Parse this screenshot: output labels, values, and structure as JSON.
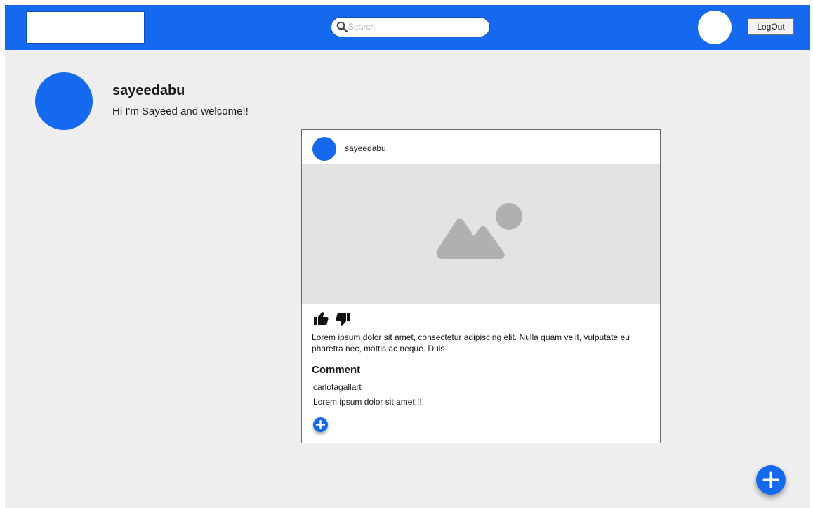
{
  "navbar": {
    "search": {
      "placeholder": "Search",
      "icon": "search-icon"
    },
    "logout_label": "LogOut",
    "accent_color": "#1569ef"
  },
  "profile": {
    "username": "sayeedabu",
    "bio": "Hi I'm Sayeed and welcome!!"
  },
  "post": {
    "author": "sayeedabu",
    "image_icon": "image-placeholder-icon",
    "reactions": [
      "thumbs-up-icon",
      "thumbs-down-icon"
    ],
    "text": "Lorem ipsum dolor sit amet, consectetur adipiscing elit. Nulla quam velit, vulputate eu pharetra nec, mattis ac neque. Duis",
    "comments_heading": "Comment",
    "comments": [
      {
        "user": "carlotagallart",
        "text": "Lorem ipsum dolor sit amet!!!!"
      }
    ],
    "add_comment_icon": "plus-icon"
  },
  "fab_icon": "plus-icon"
}
